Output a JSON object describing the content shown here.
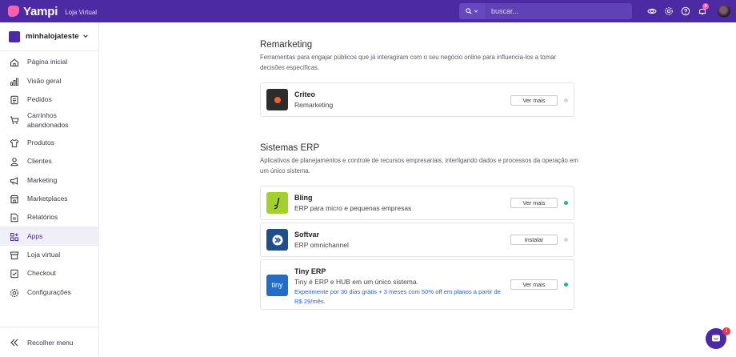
{
  "header": {
    "brand": "Yampi",
    "subtitle": "Loja Virtual",
    "search_placeholder": "buscar...",
    "notification_count": "8",
    "icons": [
      "eye-icon",
      "gear-icon",
      "help-icon",
      "bell-icon"
    ]
  },
  "sidebar": {
    "store_name": "minhalojateste",
    "items": [
      {
        "label": "Página inicial",
        "icon": "home-icon"
      },
      {
        "label": "Visão geral",
        "icon": "chart-icon"
      },
      {
        "label": "Pedidos",
        "icon": "document-icon"
      },
      {
        "label": "Carrinhos abandonados",
        "icon": "cart-icon"
      },
      {
        "label": "Produtos",
        "icon": "shirt-icon"
      },
      {
        "label": "Clientes",
        "icon": "user-icon"
      },
      {
        "label": "Marketing",
        "icon": "megaphone-icon"
      },
      {
        "label": "Marketplaces",
        "icon": "store-icon"
      },
      {
        "label": "Relatórios",
        "icon": "report-icon"
      },
      {
        "label": "Apps",
        "icon": "apps-icon",
        "active": true
      },
      {
        "label": "Loja virtual",
        "icon": "shop-icon"
      },
      {
        "label": "Checkout",
        "icon": "checkout-icon"
      },
      {
        "label": "Configurações",
        "icon": "gear-icon"
      }
    ],
    "collapse_label": "Recolher menu"
  },
  "sections": [
    {
      "title": "Remarketing",
      "description": "Ferramentas para engajar públicos que já interagiram com o seu negócio online para influencia-los a tomar decisões específicas.",
      "apps": [
        {
          "name": "Criteo",
          "category": "Remarketing",
          "button": "Ver mais",
          "status": "inactive",
          "logo": "criteo-logo"
        }
      ]
    },
    {
      "title": "Sistemas ERP",
      "description": "Aplicativos de planejamentos e controle de recursos empresariais, interligando dados e processos da operação em um único sistema.",
      "apps": [
        {
          "name": "Bling",
          "category": "ERP para micro e pequenas empresas",
          "button": "Ver mais",
          "status": "active",
          "logo": "bling-logo"
        },
        {
          "name": "Softvar",
          "category": "ERP omnichannel",
          "button": "Instalar",
          "status": "inactive",
          "logo": "softvar-logo"
        },
        {
          "name": "Tiny ERP",
          "category": "Tiny é ERP e HUB em um único sistema.",
          "promo": "Experimente por 30 dias grátis + 3 meses com 50% off em planos a partir de R$ 29/mês.",
          "button": "Ver mais",
          "status": "active",
          "logo": "tiny-logo",
          "logo_text": "tiny"
        }
      ]
    }
  ],
  "chat": {
    "badge": "1"
  },
  "colors": {
    "primary": "#4b2aa3",
    "brand_pink": "#ff5fae",
    "status_active": "#1fb886",
    "status_inactive": "#d4d4da",
    "link_blue": "#2c5ed9"
  }
}
